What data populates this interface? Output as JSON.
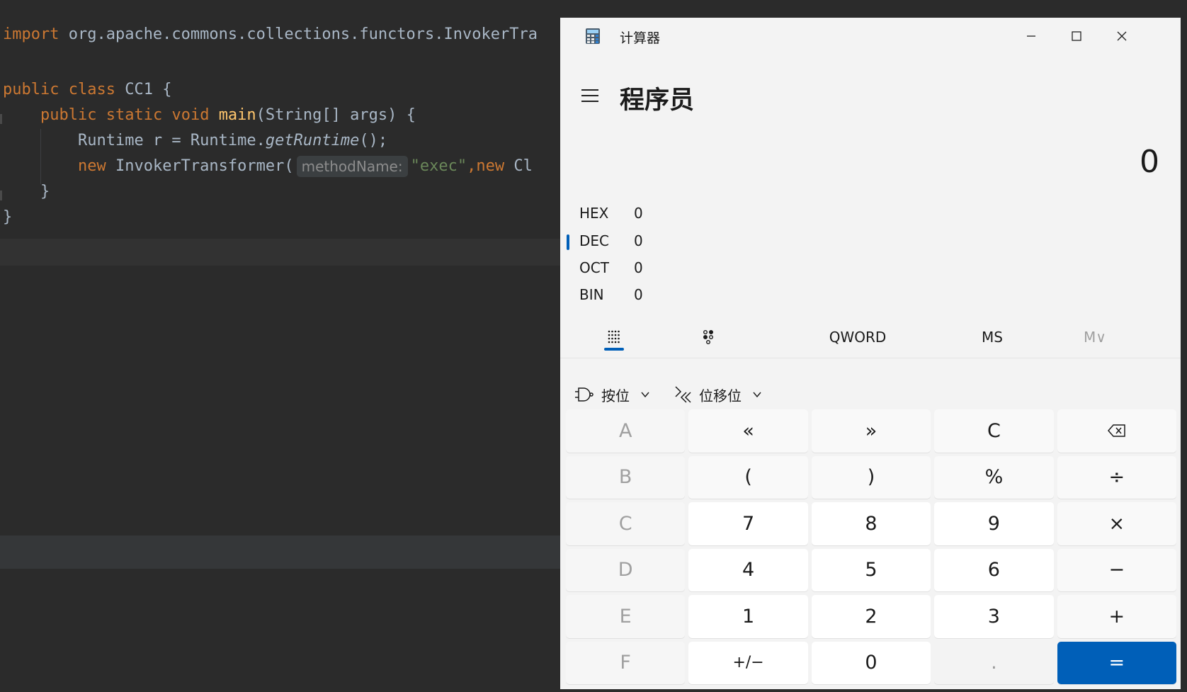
{
  "ide": {
    "line1": {
      "kw": "import",
      "rest": " org.apache.commons.collections.functors.InvokerTra"
    },
    "line2": {
      "kw1": "public",
      "kw2": "class",
      "name": " CC1 {"
    },
    "line3": {
      "kw1": "public",
      "kw2": "static",
      "kw3": "void",
      "fn": "main",
      "rest": "(String[] args) {"
    },
    "line4": {
      "a": "Runtime r = Runtime.",
      "it": "getRuntime",
      "b": "();"
    },
    "line5": {
      "kw": "new",
      "cls": " InvokerTransformer(",
      "hint": "methodName:",
      "str": "\"exec\"",
      "comma": ",",
      "kw2": "new",
      "rest": " Cl"
    },
    "line6": "}",
    "line7": "}"
  },
  "calc": {
    "title": "计算器",
    "mode": "程序员",
    "display": "0",
    "radix": [
      {
        "name": "HEX",
        "value": "0"
      },
      {
        "name": "DEC",
        "value": "0"
      },
      {
        "name": "OCT",
        "value": "0"
      },
      {
        "name": "BIN",
        "value": "0"
      }
    ],
    "toolbar": {
      "word": "QWORD",
      "ms": "MS",
      "m": "M∨"
    },
    "bitwise": "按位",
    "shift": "位移位",
    "keys": {
      "A": "A",
      "lshift": "«",
      "rshift": "»",
      "C": "C",
      "back": "⌫",
      "B": "B",
      "lparen": "(",
      "rparen": ")",
      "mod": "%",
      "div": "÷",
      "Ch": "C",
      "k7": "7",
      "k8": "8",
      "k9": "9",
      "mul": "×",
      "D": "D",
      "k4": "4",
      "k5": "5",
      "k6": "6",
      "sub": "−",
      "E": "E",
      "k1": "1",
      "k2": "2",
      "k3": "3",
      "add": "+",
      "F": "F",
      "neg": "+/−",
      "k0": "0",
      "dot": ".",
      "eq": "="
    },
    "colors": {
      "accent": "#005fb8"
    }
  }
}
